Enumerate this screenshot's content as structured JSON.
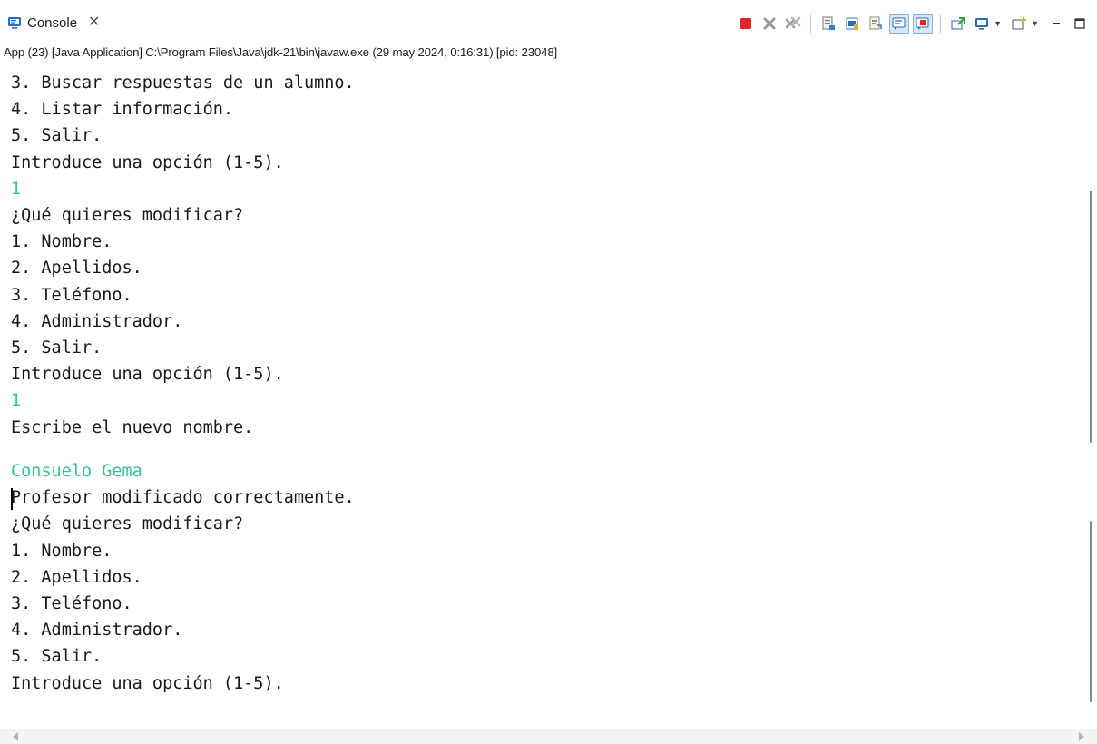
{
  "tab": {
    "label": "Console",
    "icon": "console-icon",
    "close_glyph": "✕"
  },
  "toolbar": {
    "buttons": [
      {
        "name": "terminate-icon",
        "color": "#e0262b"
      },
      {
        "name": "remove-launch-icon"
      },
      {
        "name": "remove-all-terminated-icon"
      },
      {
        "name": "clear-console-icon"
      },
      {
        "name": "scroll-lock-icon"
      },
      {
        "name": "word-wrap-icon"
      },
      {
        "name": "show-console-on-stdout-icon",
        "pressed": true
      },
      {
        "name": "show-console-on-stderr-icon",
        "pressed": true
      },
      {
        "name": "pin-console-icon"
      },
      {
        "name": "display-selected-console-icon"
      },
      {
        "name": "open-console-icon"
      },
      {
        "name": "minimize-icon"
      },
      {
        "name": "maximize-icon"
      }
    ]
  },
  "process_title": "App (23) [Java Application] C:\\Program Files\\Java\\jdk-21\\bin\\javaw.exe  (29 may 2024, 0:16:31) [pid: 23048]",
  "panel_a": {
    "lines": [
      {
        "text": "3. Buscar respuestas de un alumno.",
        "type": "output"
      },
      {
        "text": "4. Listar información.",
        "type": "output"
      },
      {
        "text": "5. Salir.",
        "type": "output"
      },
      {
        "text": "Introduce una opción (1-5).",
        "type": "output"
      },
      {
        "text": "1",
        "type": "input"
      },
      {
        "text": "¿Qué quieres modificar?",
        "type": "output"
      },
      {
        "text": "1. Nombre.",
        "type": "output"
      },
      {
        "text": "2. Apellidos.",
        "type": "output"
      },
      {
        "text": "3. Teléfono.",
        "type": "output"
      },
      {
        "text": "4. Administrador.",
        "type": "output"
      },
      {
        "text": "5. Salir.",
        "type": "output"
      },
      {
        "text": "Introduce una opción (1-5).",
        "type": "output"
      },
      {
        "text": "1",
        "type": "input"
      },
      {
        "text": "Escribe el nuevo nombre.",
        "type": "output"
      }
    ]
  },
  "panel_b": {
    "lines": [
      {
        "text": "Consuelo Gema",
        "type": "input"
      },
      {
        "text": "Profesor modificado correctamente.",
        "type": "output"
      },
      {
        "text": "¿Qué quieres modificar?",
        "type": "output"
      },
      {
        "text": "1. Nombre.",
        "type": "output"
      },
      {
        "text": "2. Apellidos.",
        "type": "output"
      },
      {
        "text": "3. Teléfono.",
        "type": "output"
      },
      {
        "text": "4. Administrador.",
        "type": "output"
      },
      {
        "text": "5. Salir.",
        "type": "output"
      },
      {
        "text": "Introduce una opción (1-5).",
        "type": "output"
      }
    ]
  },
  "colors": {
    "input_text": "#2bcc93",
    "output_text": "#1a1a1a"
  }
}
